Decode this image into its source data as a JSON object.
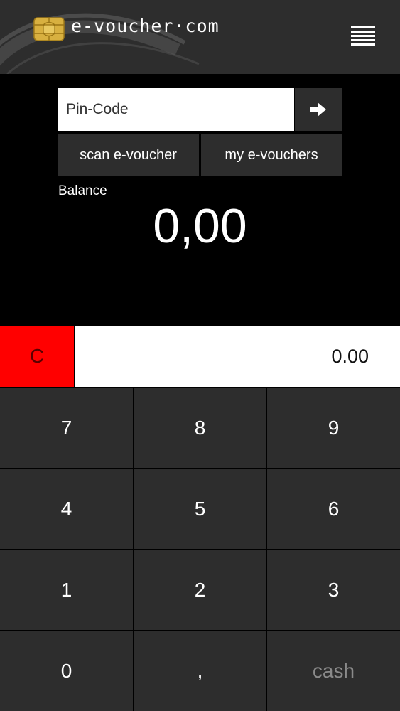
{
  "header": {
    "logo_text": "e-voucher·com",
    "logo_icon": "sim-chip-icon",
    "menu_icon": "hamburger-menu-icon"
  },
  "pin": {
    "placeholder": "Pin-Code",
    "value": "",
    "submit_icon": "arrow-right-icon"
  },
  "actions": {
    "scan_label": "scan e-voucher",
    "my_vouchers_label": "my e-vouchers"
  },
  "balance": {
    "label": "Balance",
    "value": "0,00"
  },
  "amount": {
    "clear_label": "C",
    "value": "0.00"
  },
  "keypad": {
    "keys": [
      "7",
      "8",
      "9",
      "4",
      "5",
      "6",
      "1",
      "2",
      "3",
      "0",
      ",",
      "cash"
    ]
  },
  "colors": {
    "background": "#000000",
    "panel": "#2d2d2d",
    "clear_red": "#ff0000",
    "chip_gold": "#d8b040"
  }
}
